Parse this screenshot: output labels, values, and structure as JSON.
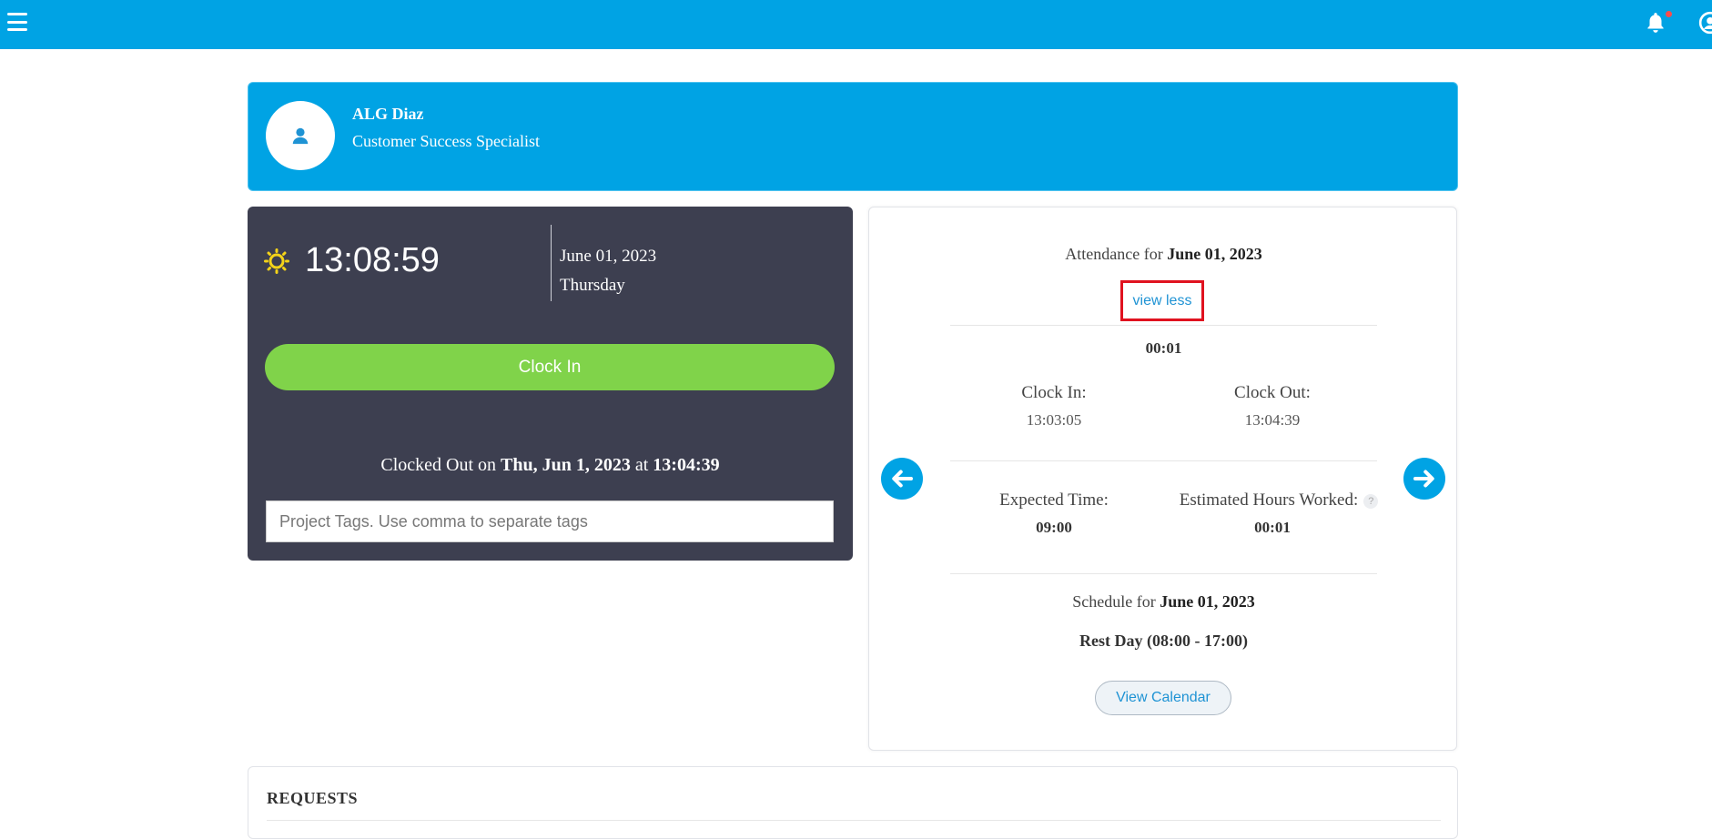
{
  "header": {
    "menu_icon": "hamburger-menu-icon",
    "notification_icon": "bell-icon",
    "user_icon": "user-circle-icon",
    "brand_color": "#00a3e4",
    "notification_dot_color": "#ff4b4b"
  },
  "profile": {
    "name": "ALG Diaz",
    "role": "Customer Success Specialist",
    "avatar_icon": "user-icon"
  },
  "clock": {
    "weather_icon": "sun-icon",
    "time": "13:08:59",
    "date": "June 01, 2023",
    "day": "Thursday",
    "clock_in_label": "Clock In",
    "clock_in_color": "#80d34a",
    "clocked_out_prefix": "Clocked Out on",
    "clocked_out_date": "Thu, Jun 1, 2023",
    "clocked_out_at": "at",
    "clocked_out_time": "13:04:39",
    "tags_placeholder": "Project Tags. Use comma to separate tags"
  },
  "attendance": {
    "title_prefix": "Attendance for",
    "title_date": "June 01, 2023",
    "view_less_label": "view less",
    "duration": "00:01",
    "clock_in_label": "Clock In:",
    "clock_in_value": "13:03:05",
    "clock_out_label": "Clock Out:",
    "clock_out_value": "13:04:39",
    "expected_label": "Expected Time:",
    "expected_value": "09:00",
    "estimated_label": "Estimated Hours Worked:",
    "estimated_value": "00:01",
    "help_icon_glyph": "?",
    "schedule_prefix": "Schedule for",
    "schedule_date": "June 01, 2023",
    "schedule_type": "Rest Day",
    "schedule_hours": "(08:00 - 17:00)",
    "view_calendar_label": "View Calendar",
    "prev_icon": "arrow-left-circle-icon",
    "next_icon": "arrow-right-circle-icon"
  },
  "requests": {
    "title": "REQUESTS"
  }
}
